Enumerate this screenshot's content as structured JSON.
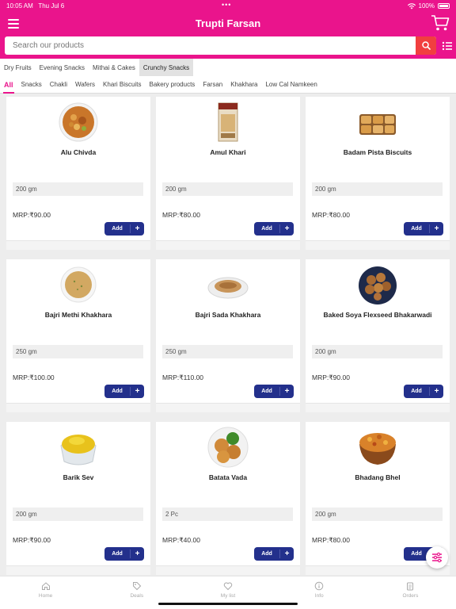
{
  "status": {
    "time": "10:05 AM",
    "date": "Thu Jul 6",
    "battery": "100%"
  },
  "header": {
    "title": "Trupti Farsan",
    "menu_icon": "hamburger-icon",
    "cart_icon": "cart-icon"
  },
  "search": {
    "placeholder": "Search our products",
    "value": ""
  },
  "categories": [
    {
      "label": "Dry Fruits"
    },
    {
      "label": "Evening Snacks"
    },
    {
      "label": "Mithai & Cakes"
    },
    {
      "label": "Crunchy Snacks"
    }
  ],
  "active_category": "Crunchy Snacks",
  "subcategories": [
    {
      "label": "All"
    },
    {
      "label": "Snacks"
    },
    {
      "label": "Chakli"
    },
    {
      "label": "Wafers"
    },
    {
      "label": "Khari Biscuits"
    },
    {
      "label": "Bakery products"
    },
    {
      "label": "Farsan"
    },
    {
      "label": "Khakhara"
    },
    {
      "label": "Low Cal Namkeen"
    }
  ],
  "active_subcategory": "All",
  "add_label": "Add",
  "products": [
    {
      "name": "Alu Chivda",
      "qty": "200 gm",
      "price": "MRP:₹90.00"
    },
    {
      "name": "Amul Khari",
      "qty": "200 gm",
      "price": "MRP:₹80.00"
    },
    {
      "name": "Badam Pista Biscuits",
      "qty": "200 gm",
      "price": "MRP:₹80.00"
    },
    {
      "name": "Bajri Methi Khakhara",
      "qty": "250 gm",
      "price": "MRP:₹100.00"
    },
    {
      "name": "Bajri Sada Khakhara",
      "qty": "250 gm",
      "price": "MRP:₹110.00"
    },
    {
      "name": "Baked Soya Flexseed Bhakarwadi",
      "qty": "200 gm",
      "price": "MRP:₹90.00"
    },
    {
      "name": "Barik Sev",
      "qty": "200 gm",
      "price": "MRP:₹90.00"
    },
    {
      "name": "Batata Vada",
      "qty": "2 Pc",
      "price": "MRP:₹40.00"
    },
    {
      "name": "Bhadang Bhel",
      "qty": "200 gm",
      "price": "MRP:₹80.00"
    }
  ],
  "bottom_nav": [
    {
      "label": "Home",
      "icon": "home-icon"
    },
    {
      "label": "Deals",
      "icon": "tag-icon"
    },
    {
      "label": "My list",
      "icon": "heart-icon"
    },
    {
      "label": "Info",
      "icon": "info-icon"
    },
    {
      "label": "Orders",
      "icon": "clipboard-icon"
    }
  ],
  "colors": {
    "brand": "#ea148c",
    "button": "#23308c",
    "search_button": "#f13f3f"
  }
}
